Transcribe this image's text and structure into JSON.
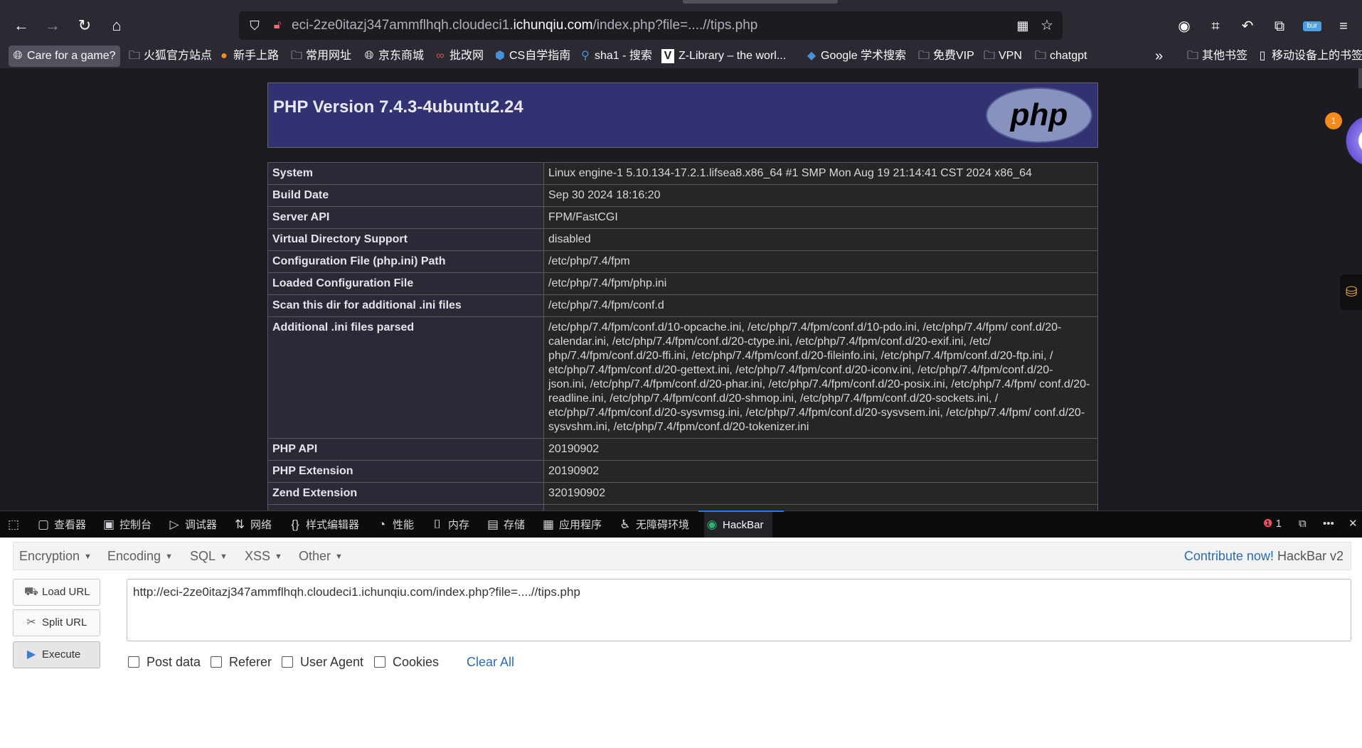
{
  "browser": {
    "url_prefix": "eci-2ze0itazj347ammflhqh.cloudeci1.",
    "url_host": "ichunqiu.com",
    "url_suffix": "/index.php?file=....//tips.php",
    "extension_badge": "bur"
  },
  "bookmarks": [
    {
      "label": "Care for a game?",
      "icon": "globe-icon"
    },
    {
      "label": "火狐官方站点",
      "icon": "folder-icon"
    },
    {
      "label": "新手上路",
      "icon": "firefox-icon"
    },
    {
      "label": "常用网址",
      "icon": "folder-icon"
    },
    {
      "label": "京东商城",
      "icon": "globe-icon"
    },
    {
      "label": "批改网",
      "icon": "pigai-icon"
    },
    {
      "label": "CS自学指南",
      "icon": "cs-icon"
    },
    {
      "label": "sha1 - 搜索",
      "icon": "search-icon"
    },
    {
      "label": "Z-Library – the worl...",
      "icon": "zlib-icon"
    },
    {
      "label": "Google 学术搜索",
      "icon": "scholar-icon"
    },
    {
      "label": "免费VIP",
      "icon": "folder-icon"
    },
    {
      "label": "VPN",
      "icon": "folder-icon"
    },
    {
      "label": "chatgpt",
      "icon": "folder-icon"
    },
    {
      "label": "其他书签",
      "icon": "folder-icon"
    },
    {
      "label": "移动设备上的书签",
      "icon": "mobile-icon"
    }
  ],
  "phpinfo": {
    "title": "PHP Version 7.4.3-4ubuntu2.24",
    "logo_text": "php",
    "rows": [
      {
        "key": "System",
        "value": "Linux engine-1 5.10.134-17.2.1.lifsea8.x86_64 #1 SMP Mon Aug 19 21:14:41 CST 2024 x86_64"
      },
      {
        "key": "Build Date",
        "value": "Sep 30 2024 18:16:20"
      },
      {
        "key": "Server API",
        "value": "FPM/FastCGI"
      },
      {
        "key": "Virtual Directory Support",
        "value": "disabled"
      },
      {
        "key": "Configuration File (php.ini) Path",
        "value": "/etc/php/7.4/fpm"
      },
      {
        "key": "Loaded Configuration File",
        "value": "/etc/php/7.4/fpm/php.ini"
      },
      {
        "key": "Scan this dir for additional .ini files",
        "value": "/etc/php/7.4/fpm/conf.d"
      },
      {
        "key": "Additional .ini files parsed",
        "value": "/etc/php/7.4/fpm/conf.d/10-opcache.ini, /etc/php/7.4/fpm/conf.d/10-pdo.ini, /etc/php/7.4/fpm/ conf.d/20-calendar.ini, /etc/php/7.4/fpm/conf.d/20-ctype.ini, /etc/php/7.4/fpm/conf.d/20-exif.ini, /etc/ php/7.4/fpm/conf.d/20-ffi.ini, /etc/php/7.4/fpm/conf.d/20-fileinfo.ini, /etc/php/7.4/fpm/conf.d/20-ftp.ini, / etc/php/7.4/fpm/conf.d/20-gettext.ini, /etc/php/7.4/fpm/conf.d/20-iconv.ini, /etc/php/7.4/fpm/conf.d/20- json.ini, /etc/php/7.4/fpm/conf.d/20-phar.ini, /etc/php/7.4/fpm/conf.d/20-posix.ini, /etc/php/7.4/fpm/ conf.d/20-readline.ini, /etc/php/7.4/fpm/conf.d/20-shmop.ini, /etc/php/7.4/fpm/conf.d/20-sockets.ini, / etc/php/7.4/fpm/conf.d/20-sysvmsg.ini, /etc/php/7.4/fpm/conf.d/20-sysvsem.ini, /etc/php/7.4/fpm/ conf.d/20-sysvshm.ini, /etc/php/7.4/fpm/conf.d/20-tokenizer.ini"
      },
      {
        "key": "PHP API",
        "value": "20190902"
      },
      {
        "key": "PHP Extension",
        "value": "20190902"
      },
      {
        "key": "Zend Extension",
        "value": "320190902"
      }
    ]
  },
  "side_widget": {
    "badge": "1"
  },
  "devtools": {
    "tabs": [
      {
        "label": "查看器",
        "icon": "inspector-icon"
      },
      {
        "label": "控制台",
        "icon": "console-icon"
      },
      {
        "label": "调试器",
        "icon": "debugger-icon"
      },
      {
        "label": "网络",
        "icon": "network-icon"
      },
      {
        "label": "样式编辑器",
        "icon": "style-editor-icon"
      },
      {
        "label": "性能",
        "icon": "performance-icon"
      },
      {
        "label": "内存",
        "icon": "memory-icon"
      },
      {
        "label": "存储",
        "icon": "storage-icon"
      },
      {
        "label": "应用程序",
        "icon": "application-icon"
      },
      {
        "label": "无障碍环境",
        "icon": "accessibility-icon"
      },
      {
        "label": "HackBar",
        "icon": "hackbar-icon"
      }
    ],
    "error_count": "1"
  },
  "hackbar": {
    "menus": [
      "Encryption",
      "Encoding",
      "SQL",
      "XSS",
      "Other"
    ],
    "contribute": "Contribute now!",
    "version": "HackBar v2",
    "load_url": "Load URL",
    "split_url": "Split URL",
    "execute": "Execute",
    "url_value": "http://eci-2ze0itazj347ammflhqh.cloudeci1.ichunqiu.com/index.php?file=....//tips.php",
    "checkboxes": [
      "Post data",
      "Referer",
      "User Agent",
      "Cookies"
    ],
    "clear_all": "Clear All"
  }
}
